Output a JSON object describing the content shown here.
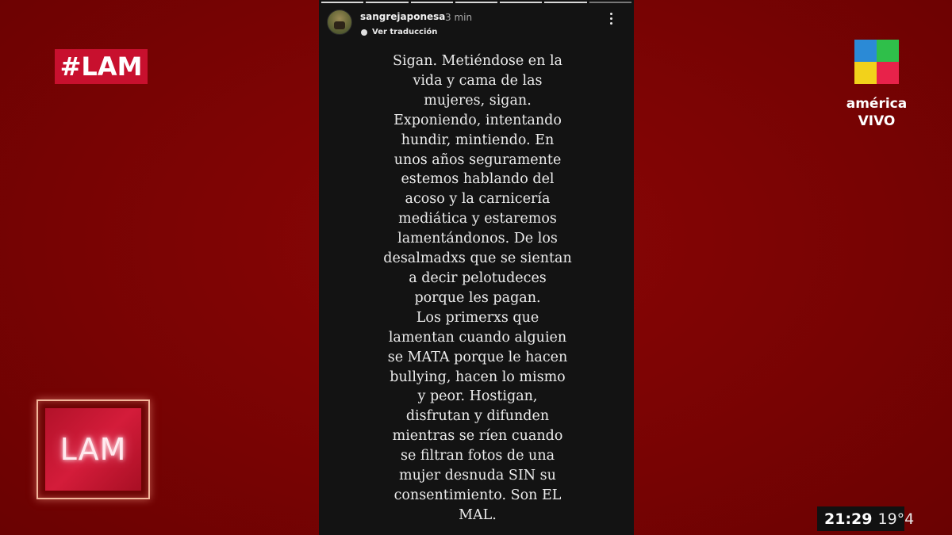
{
  "overlay": {
    "hashtag": "#LAM",
    "show_logo": "LAM",
    "channel": {
      "line1": "américa",
      "line2": "VIVO"
    },
    "clock": {
      "time": "21:29",
      "temp": "19°4"
    }
  },
  "story": {
    "username": "sangrejaponesa",
    "time_ago": "3 min",
    "translate_label": "Ver traducción",
    "progress_segments": 7,
    "message_lines": [
      "Sigan. Metiéndose en la",
      "vida y cama de las",
      "mujeres, sigan.",
      "Exponiendo, intentando",
      "hundir, mintiendo. En",
      "unos años seguramente",
      "estemos hablando del",
      "acoso y la carnicería",
      "mediática y estaremos",
      "lamentándonos. De los",
      "desalmadxs que se sientan",
      "a decir pelotudeces",
      "porque les pagan.",
      "Los primerxs que",
      "lamentan cuando alguien",
      "se MATA porque le hacen",
      "bullying, hacen lo mismo",
      "y peor. Hostigan,",
      "disfrutan y difunden",
      "mientras se ríen cuando",
      "se filtran fotos de una",
      "mujer desnuda SIN su",
      "consentimiento. Son EL",
      "MAL."
    ]
  },
  "colors": {
    "background": "#7a0404",
    "hashtag_bg": "#c8102e",
    "story_bg": "#131313",
    "channel_cube": [
      "#2b8ad6",
      "#2fbf4a",
      "#f2d21b",
      "#e8224a"
    ]
  },
  "icons": {
    "more": "vertical-ellipsis-icon",
    "translate": "globe-icon"
  }
}
